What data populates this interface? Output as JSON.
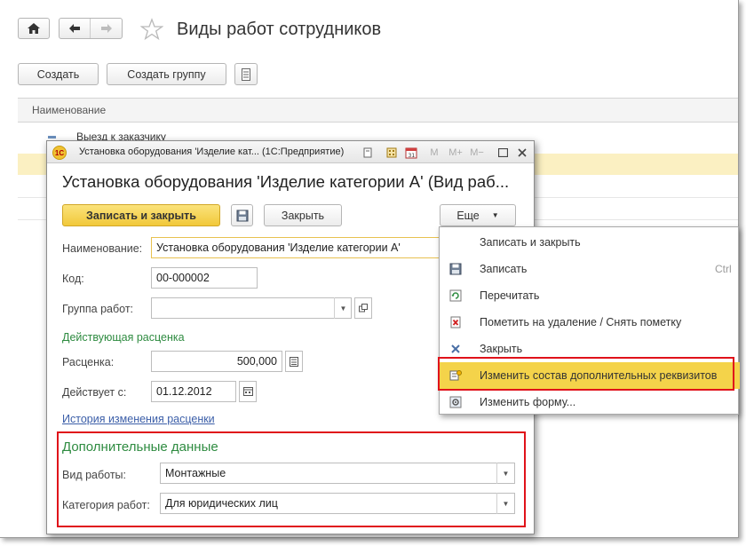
{
  "toolbar": {
    "create_label": "Создать",
    "create_group_label": "Создать группу"
  },
  "page_title": "Виды работ сотрудников",
  "list": {
    "column_name": "Наименование",
    "group_row": "Выезд к заказчику"
  },
  "dialog": {
    "window_title": "Установка оборудования 'Изделие кат... (1С:Предприятие)",
    "form_title": "Установка оборудования 'Изделие категории А' (Вид раб...",
    "save_close_label": "Записать и закрыть",
    "close_label": "Закрыть",
    "more_label": "Еще",
    "fields": {
      "name_label": "Наименование:",
      "name_value": "Установка оборудования 'Изделие категории А'",
      "code_label": "Код:",
      "code_value": "00-000002",
      "group_label": "Группа работ:",
      "group_value": "",
      "rate_section": "Действующая расценка",
      "rate_label": "Расценка:",
      "rate_value": "500,000",
      "valid_from_label": "Действует с:",
      "valid_from_value": "01.12.2012",
      "history_link": "История изменения расценки"
    },
    "additional": {
      "title": "Дополнительные данные",
      "work_type_label": "Вид работы:",
      "work_type_value": "Монтажные",
      "category_label": "Категория работ:",
      "category_value": "Для юридических лиц"
    }
  },
  "menu": {
    "items": [
      {
        "label": "Записать и закрыть",
        "icon": "none"
      },
      {
        "label": "Записать",
        "icon": "save-icon",
        "shortcut": "Ctrl"
      },
      {
        "label": "Перечитать",
        "icon": "refresh-icon"
      },
      {
        "label": "Пометить на удаление / Снять пометку",
        "icon": "delete-mark-icon"
      },
      {
        "label": "Закрыть",
        "icon": "close-icon"
      },
      {
        "label": "Изменить состав дополнительных реквизитов",
        "icon": "edit-attributes-icon"
      },
      {
        "label": "Изменить форму...",
        "icon": "form-settings-icon"
      }
    ]
  },
  "colors": {
    "accent_yellow": "#f4d34a",
    "highlight_red": "#e0121a",
    "section_green": "#2e8b40",
    "link_blue": "#3b5ea8"
  }
}
